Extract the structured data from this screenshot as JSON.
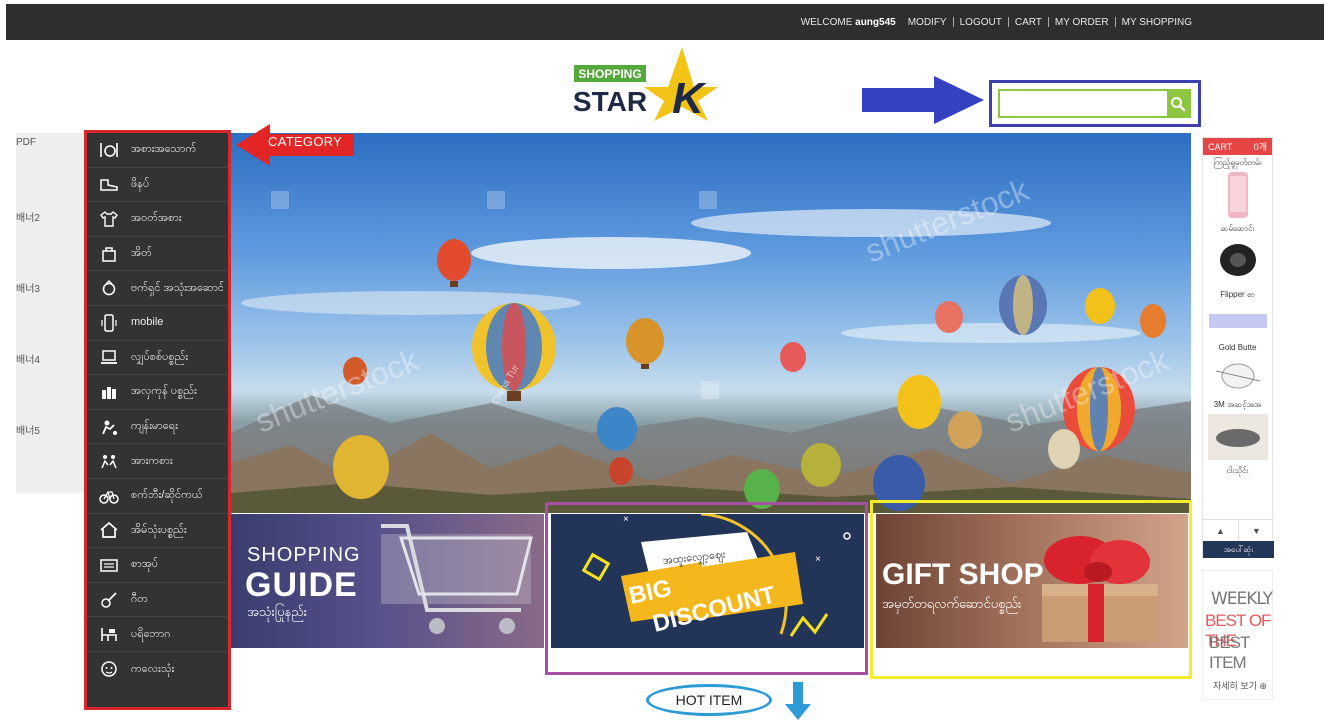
{
  "topbar": {
    "welcome": "WELCOME",
    "username": "aung545",
    "links": [
      "MODIFY",
      "LOGOUT",
      "CART",
      "MY ORDER",
      "MY SHOPPING"
    ]
  },
  "logo": {
    "line1": "SHOPPING",
    "line2": "STAR",
    "mark": "K"
  },
  "search": {
    "placeholder": "",
    "icon": "search-icon",
    "accent": "#8dc63f"
  },
  "annotations": {
    "category_label": "CATEGORY",
    "hot_item": "HOT ITEM"
  },
  "left_links": [
    "PDF",
    "배너2",
    "배너3",
    "배너4",
    "배너5"
  ],
  "categories": [
    {
      "label": "အစားအသောက်",
      "icon": "dining-icon"
    },
    {
      "label": "ဖိနပ်",
      "icon": "shoe-icon"
    },
    {
      "label": "အဝတ်အစား",
      "icon": "shirt-icon"
    },
    {
      "label": "အိတ်",
      "icon": "bag-icon"
    },
    {
      "label": "ဗက်ရှင် အသုံးအဆောင်",
      "icon": "accessory-icon"
    },
    {
      "label": "mobile",
      "icon": "mobile-icon"
    },
    {
      "label": "လျှပ်စစ်ပစ္စည်း",
      "icon": "laptop-icon"
    },
    {
      "label": "အလှကုန် ပစ္စည်း",
      "icon": "cosmetics-icon"
    },
    {
      "label": "ကျန်းမာရေး",
      "icon": "health-icon"
    },
    {
      "label": "အားကစား",
      "icon": "sports-icon"
    },
    {
      "label": "စက်ဘီး/ဆိုင်ကယ်",
      "icon": "bicycle-icon"
    },
    {
      "label": "အိမ်သုံးပစ္စည်း",
      "icon": "home-icon"
    },
    {
      "label": "စာအုပ်",
      "icon": "book-icon"
    },
    {
      "label": "ဂီတ",
      "icon": "guitar-icon"
    },
    {
      "label": "ပရိဘောဂ",
      "icon": "furniture-icon"
    },
    {
      "label": "ကလေးသုံး",
      "icon": "baby-icon"
    }
  ],
  "hero": {
    "watermark": "shutterstock",
    "credit": "Olena Tur"
  },
  "banners": {
    "guide": {
      "line1": "SHOPPING",
      "line2": "GUIDE",
      "line3": "အသုံးပြုနည်း"
    },
    "discount": {
      "tag": "အထူးလျှော့ဈေး",
      "line1": "BIG",
      "line2": "DISCOUNT"
    },
    "gift": {
      "line1": "GIFT SHOP",
      "line2": "အမှတ်တရလက်ဆောင်ပစ္စည်း"
    }
  },
  "cart": {
    "title": "CART",
    "count": "0개",
    "items": [
      {
        "label": "ကြည့်ရှုမှတ်တမ်း"
      },
      {
        "label": "ဆမ်ဆောင်း"
      },
      {
        "label": "Flipper စာ"
      },
      {
        "label": "Gold Butte"
      },
      {
        "label": "3M အဆင့်အအ"
      },
      {
        "label": "ငါးသိုင်း"
      }
    ],
    "view_all": "အပေါ်ဆုံး"
  },
  "weekly": {
    "line1": "WEEKLY",
    "line2": "BEST OF THE",
    "line3": "BEST ITEM",
    "more": "자세히 보기"
  },
  "colors": {
    "topbar": "#2e2e2e",
    "category_bg": "#333333",
    "category_frame": "#d7282e",
    "search_frame": "#3b3fb0",
    "cart_head": "#e64545"
  }
}
